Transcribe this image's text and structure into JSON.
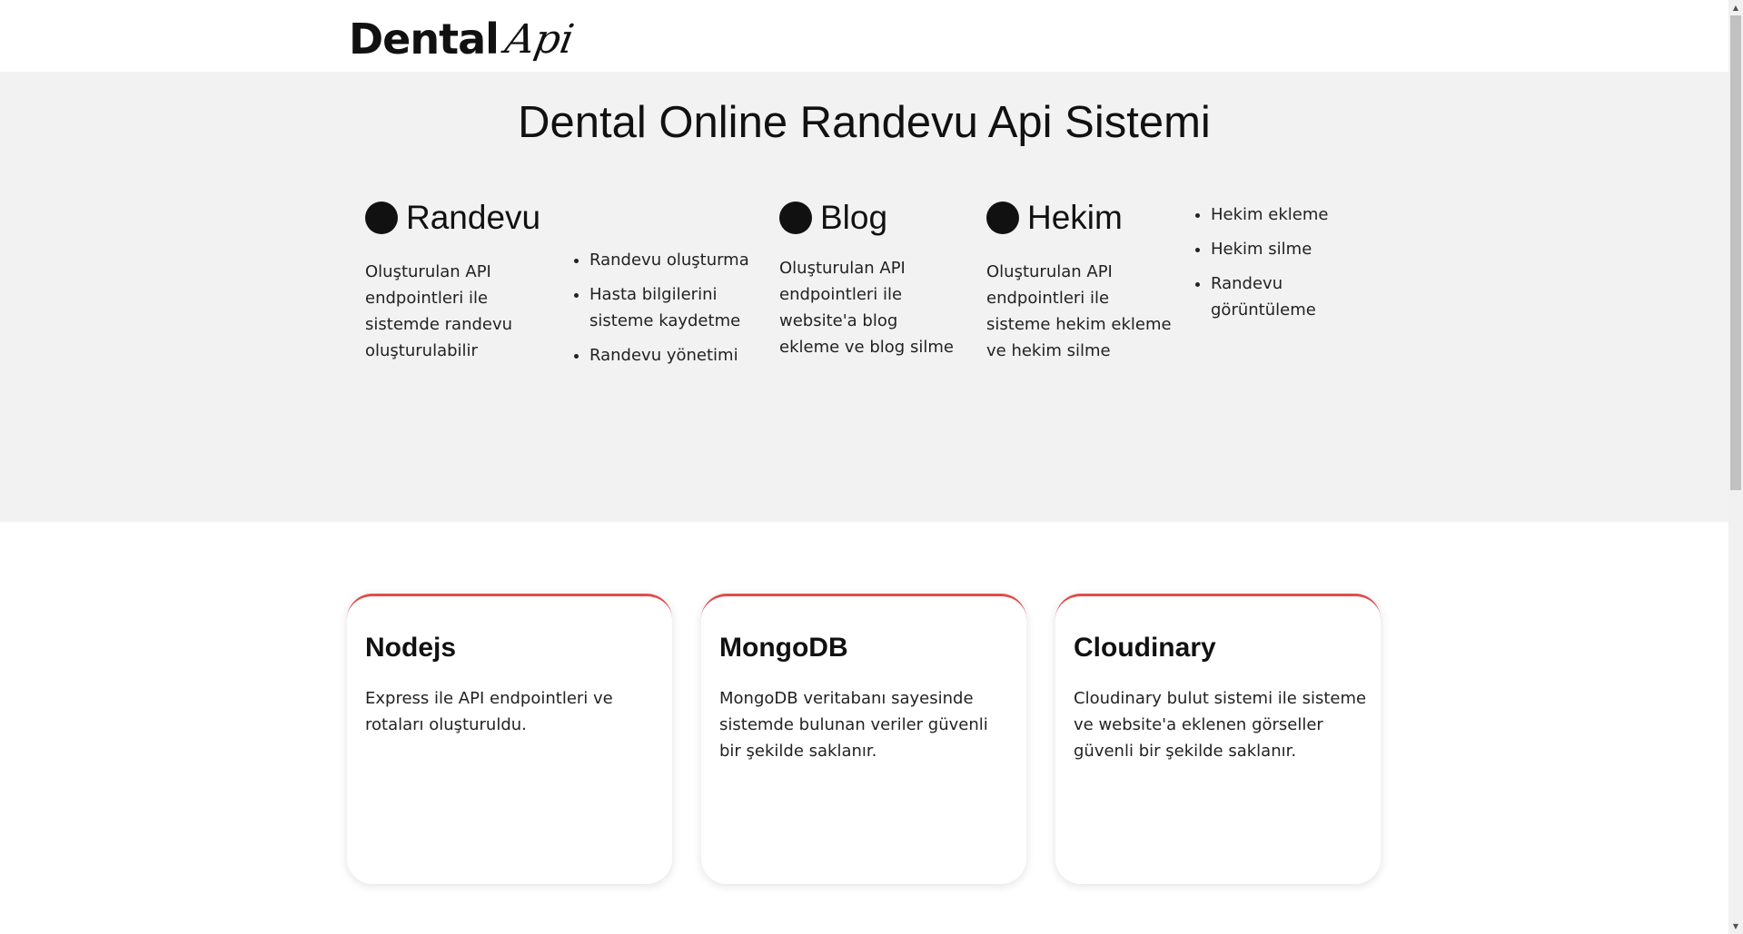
{
  "header": {
    "logo_main": "Dental",
    "logo_script": "Api"
  },
  "hero": {
    "title": "Dental Online Randevu Api Sistemi",
    "features": [
      {
        "heading": "Randevu",
        "text": "Oluşturulan API endpointleri ile sistemde randevu oluşturulabilir"
      },
      {
        "heading": "Blog",
        "text": "Oluşturulan API endpointleri ile website'a blog ekleme ve blog silme"
      },
      {
        "heading": "Hekim",
        "text": "Oluşturulan API endpointleri ile sisteme hekim ekleme ve hekim silme"
      }
    ],
    "randevu_list": [
      "Randevu oluşturma",
      "Hasta bilgilerini sisteme kaydetme",
      "Randevu yönetimi"
    ],
    "hekim_list": [
      "Hekim ekleme",
      "Hekim silme",
      "Randevu görüntüleme"
    ]
  },
  "cards": [
    {
      "title": "Nodejs",
      "text": "Express ile API endpointleri ve rotaları oluşturuldu."
    },
    {
      "title": "MongoDB",
      "text": "MongoDB veritabanı sayesinde sistemde bulunan veriler güvenli bir şekilde saklanır."
    },
    {
      "title": "Cloudinary",
      "text": "Cloudinary bulut sistemi ile sisteme ve website'a eklenen görseller güvenli bir şekilde saklanır."
    }
  ],
  "colors": {
    "hero_background": "#f2f2f2",
    "card_accent": "#e14c4c"
  },
  "icons": {
    "scroll_up": "▲",
    "scroll_down": "▼"
  }
}
